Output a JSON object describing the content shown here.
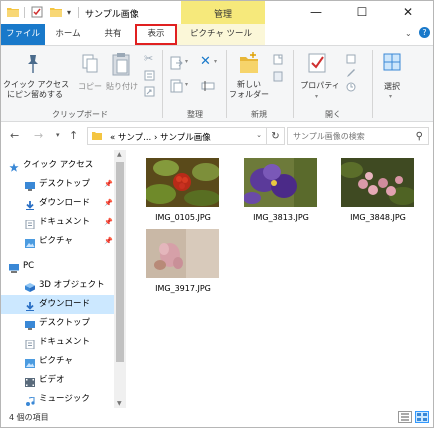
{
  "titlebar": {
    "title": "サンプル画像",
    "manage_tab": "管理",
    "minimize": "—",
    "maximize": "☐",
    "close": "✕"
  },
  "tabs": {
    "file": "ファイル",
    "home": "ホーム",
    "share": "共有",
    "view": "表示",
    "picture_tools": "ピクチャ ツール"
  },
  "ribbon": {
    "pin_quick_access": "クイック アクセス\nにピン留めする",
    "copy": "コピー",
    "paste": "貼り付け",
    "clipboard_group": "クリップボード",
    "organize_group": "整理",
    "new_folder": "新しい\nフォルダー",
    "new_group": "新規",
    "properties": "プロパティ",
    "open_group": "開く",
    "select": "選択"
  },
  "address": {
    "crumbs": "« サンプ... › サンプル画像",
    "search_placeholder": "サンプル画像の検索"
  },
  "nav": {
    "items": [
      {
        "label": "クイック アクセス",
        "icon": "star-icon",
        "pinned": false,
        "selected": false
      },
      {
        "label": "デスクトップ",
        "icon": "desktop-icon",
        "pinned": true,
        "selected": false
      },
      {
        "label": "ダウンロード",
        "icon": "download-icon",
        "pinned": true,
        "selected": false
      },
      {
        "label": "ドキュメント",
        "icon": "document-icon",
        "pinned": true,
        "selected": false
      },
      {
        "label": "ピクチャ",
        "icon": "pictures-icon",
        "pinned": true,
        "selected": false
      },
      {
        "label": "PC",
        "icon": "pc-icon",
        "pinned": false,
        "selected": false
      },
      {
        "label": "3D オブジェクト",
        "icon": "3d-objects-icon",
        "pinned": false,
        "selected": false
      },
      {
        "label": "ダウンロード",
        "icon": "download-icon",
        "pinned": false,
        "selected": true
      },
      {
        "label": "デスクトップ",
        "icon": "desktop-icon",
        "pinned": false,
        "selected": false
      },
      {
        "label": "ドキュメント",
        "icon": "document-icon",
        "pinned": false,
        "selected": false
      },
      {
        "label": "ピクチャ",
        "icon": "pictures-icon",
        "pinned": false,
        "selected": false
      },
      {
        "label": "ビデオ",
        "icon": "video-icon",
        "pinned": false,
        "selected": false
      },
      {
        "label": "ミュージック",
        "icon": "music-icon",
        "pinned": false,
        "selected": false
      }
    ]
  },
  "files": [
    {
      "name": "IMG_0105.JPG"
    },
    {
      "name": "IMG_3813.JPG"
    },
    {
      "name": "IMG_3848.JPG"
    },
    {
      "name": "IMG_3917.JPG"
    }
  ],
  "status": {
    "count": "4 個の項目"
  },
  "colors": {
    "accent": "#1979ca",
    "highlight_border": "#e02020",
    "manage_tab": "#f6e97b",
    "selected_nav": "#cce8ff"
  }
}
